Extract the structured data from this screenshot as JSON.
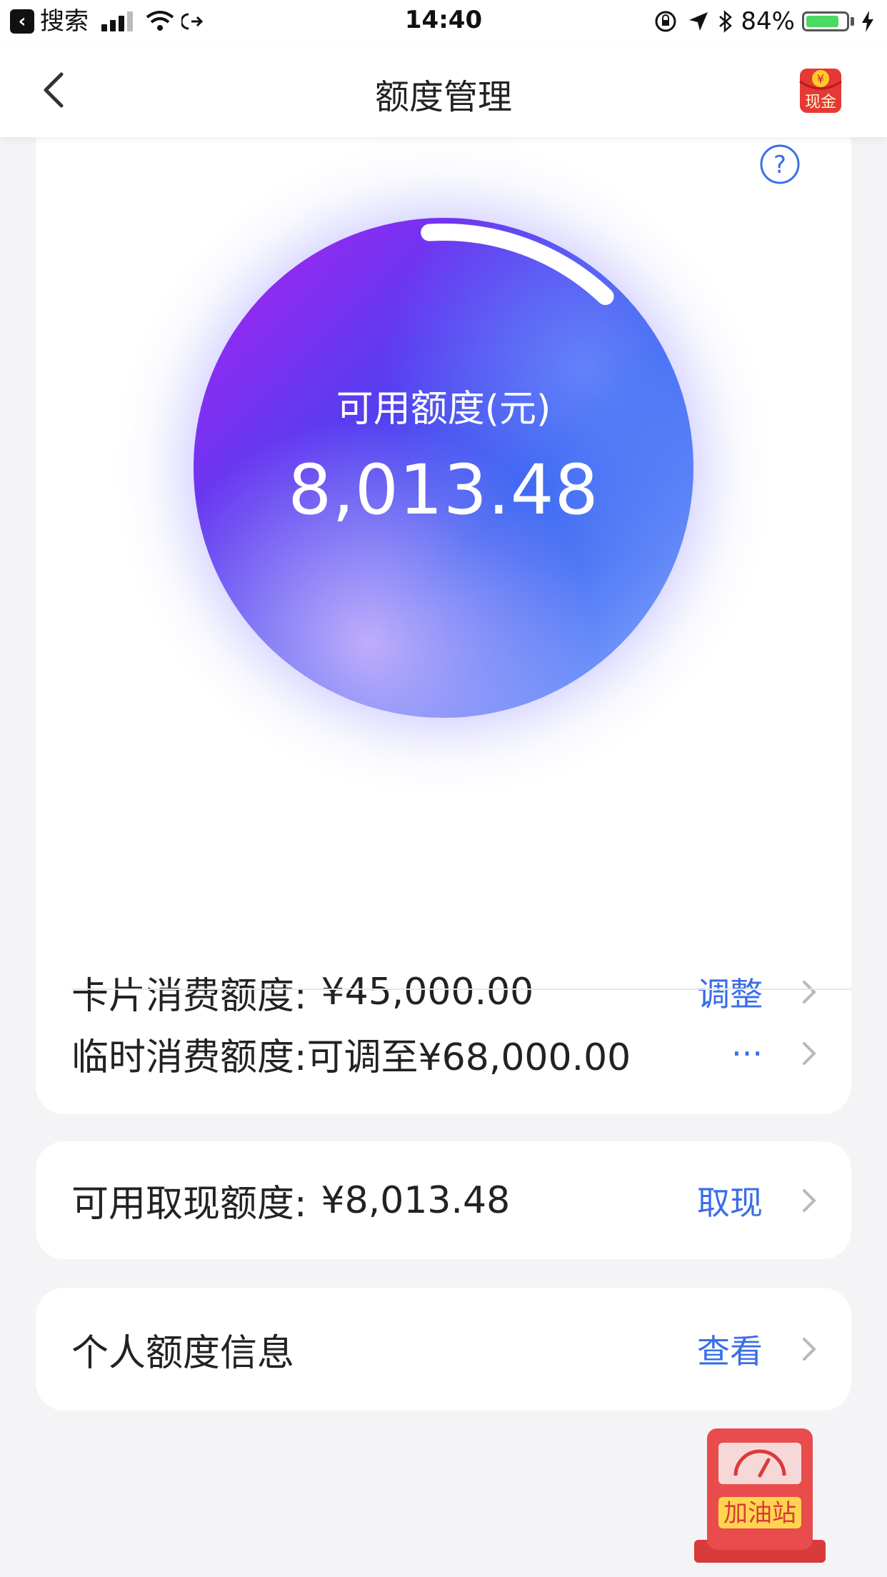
{
  "status_bar": {
    "back_app_label": "搜索",
    "time": "14:40",
    "battery_percent": "84%",
    "battery_level": 0.84
  },
  "nav": {
    "title": "额度管理",
    "back_icon": "chevron-left-icon",
    "cash_icon_text": "现金",
    "cash_icon_symbol": "¥"
  },
  "limit_circle": {
    "label": "可用额度(元)",
    "value": "8,013.48",
    "progress": 0.13
  },
  "rows": {
    "card_limit": {
      "label": "卡片消费额度:",
      "value": "¥45,000.00",
      "action": "调整"
    },
    "temp_limit": {
      "label": "临时消费额度:",
      "value": "可调至¥68,000.00",
      "action": "···"
    },
    "cash_limit": {
      "label": "可用取现额度:",
      "value": "¥8,013.48",
      "action": "取现"
    },
    "personal": {
      "label": "个人额度信息",
      "action": "查看"
    }
  },
  "gas_station": {
    "label": "加油站"
  },
  "colors": {
    "accent": "#3a6ee8",
    "circle_purple": "#a020f0",
    "circle_blue": "#2e5bf0",
    "cash_red": "#e53935"
  }
}
